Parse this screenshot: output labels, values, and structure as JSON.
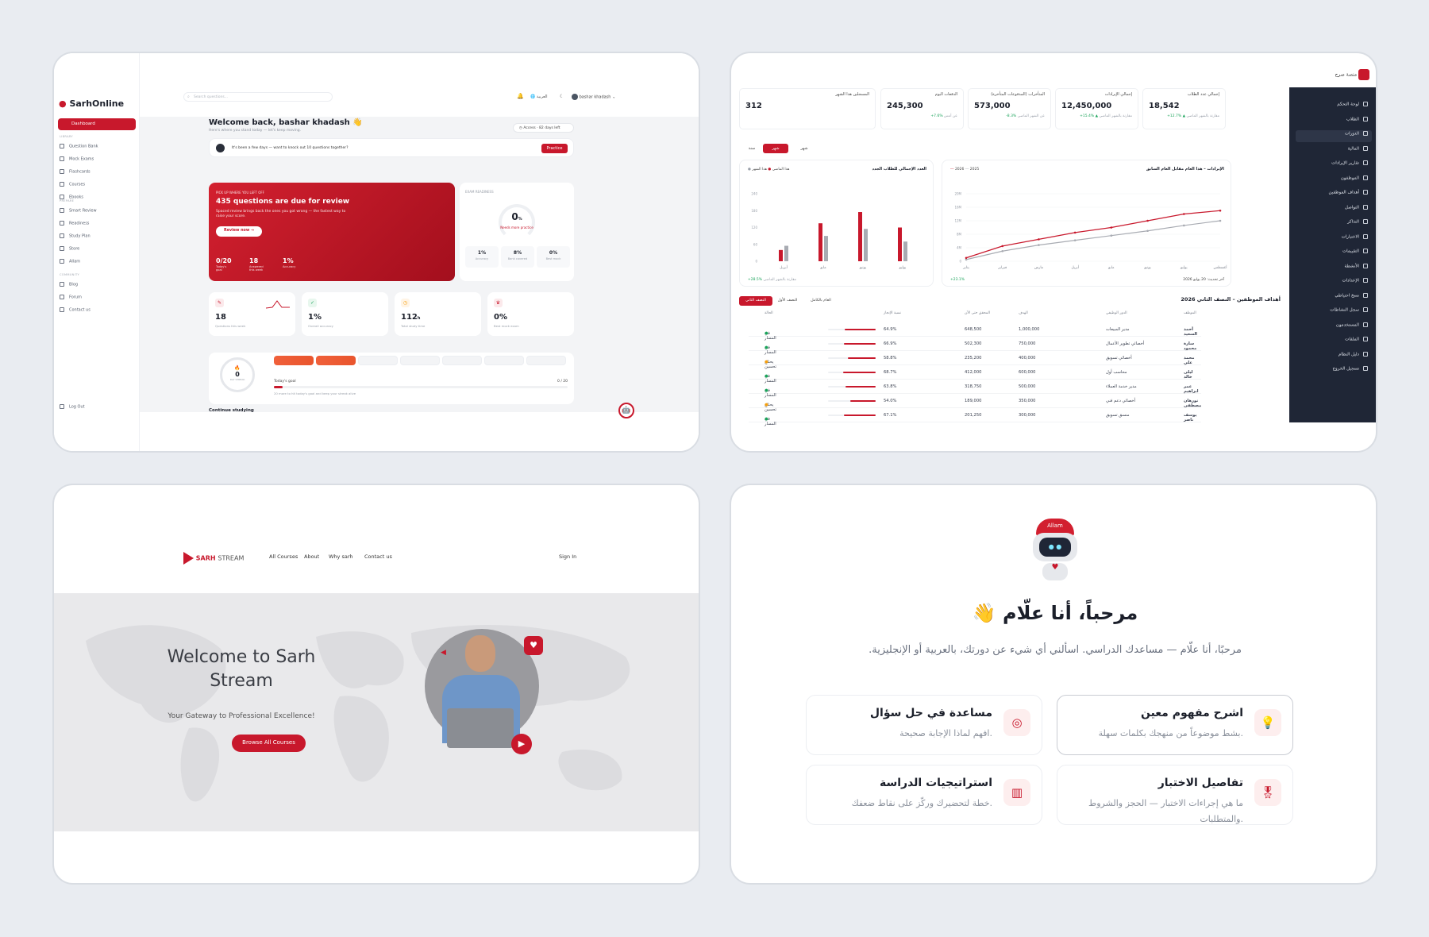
{
  "lms": {
    "logo": "SarhOnline",
    "search_placeholder": "Search questions...",
    "lang": "العربية",
    "user": "bashar khadash",
    "sidebar": {
      "active": "Dashboard",
      "sec1": "LIBRARY",
      "library": [
        "Question Bank",
        "Mock Exams",
        "Flashcards",
        "Courses",
        "Ebooks"
      ],
      "sec2": "PREPARE",
      "prepare": [
        "Smart Review",
        "Readiness",
        "Study Plan",
        "Store",
        "Allam"
      ],
      "sec3": "COMMUNITY",
      "community": [
        "Blog",
        "Forum",
        "Contact us"
      ],
      "logout": "Log Out"
    },
    "welcome": "Welcome back, bashar khadash 👋",
    "welcome_sub": "Here's where you stand today — let's keep moving.",
    "access": "Access · 82 days left",
    "nudge": "It's been a few days — want to knock out 10 questions together?",
    "nudge_btn": "Practice",
    "hero": {
      "kicker": "PICK UP WHERE YOU LEFT OFF",
      "title": "435 questions are due for review",
      "desc": "Spaced review brings back the ones you got wrong — the fastest way to raise your score.",
      "btn": "Review now →",
      "stats": [
        {
          "v": "0/20",
          "l": "Today's goal"
        },
        {
          "v": "18",
          "l": "Answered this week"
        },
        {
          "v": "1%",
          "l": "Accuracy"
        }
      ]
    },
    "readiness": {
      "label": "EXAM READINESS",
      "value": "0",
      "unit": "%",
      "status": "Needs more practice",
      "stats": [
        {
          "v": "1%",
          "l": "Accuracy"
        },
        {
          "v": "8%",
          "l": "Bank covered"
        },
        {
          "v": "0%",
          "l": "Best mock"
        }
      ]
    },
    "tiles": [
      {
        "v": "18",
        "l": "Questions this week",
        "icon": "quiz-icon"
      },
      {
        "v": "1%",
        "l": "Overall accuracy",
        "icon": "check-icon"
      },
      {
        "v": "112",
        "u": "h",
        "l": "Total study time",
        "icon": "clock-icon"
      },
      {
        "v": "0%",
        "l": "Best mock exam",
        "icon": "trophy-icon"
      }
    ],
    "streak": {
      "v": "0",
      "l": "DAY STREAK"
    },
    "goal_label": "Today's goal",
    "goal_value": "0 / 20",
    "goal_note": "20 more to hit today's goal and keep your streak alive",
    "continue": "Continue studying"
  },
  "admin": {
    "brand": "منصة صرح",
    "menu": [
      "لوحة التحكم",
      "الطلاب",
      "الدورات",
      "المالية",
      "تقارير الإيرادات",
      "الموظفون",
      "أهداف الموظفين",
      "التواصل",
      "التذاكر",
      "الاختبارات",
      "التقييمات",
      "الأنشطة",
      "الإعدادات",
      "نسخ احتياطي",
      "سجل النشاطات",
      "المستخدمون",
      "الملفات",
      "دليل النظام",
      "تسجيل الخروج"
    ],
    "kpis": [
      {
        "l": "إجمالي عدد الطلاب",
        "v": "18,542",
        "g": "+12.7% ▲",
        "n": "مقارنة بالشهر الماضي"
      },
      {
        "l": "إجمالي الإيرادات",
        "v": "12,450,000",
        "g": "+15.4% ▲",
        "n": "مقارنة بالشهر الماضي"
      },
      {
        "l": "المتأخرات (المدفوعات المتأخرة)",
        "v": "573,000",
        "g": "-8.3%",
        "n": "عن الشهر الماضي"
      },
      {
        "l": "الدفعات اليوم",
        "v": "245,300",
        "g": "+7.6%",
        "n": "عن أمس"
      },
      {
        "l": "المسجلين هذا الشهر",
        "v": "312",
        "g": "",
        "n": ""
      }
    ],
    "tabs": [
      "شهر",
      "شهر",
      "سنة"
    ],
    "line_title": "الإيرادات – هذا العام مقابل العام السابق",
    "line_legend": [
      "2026",
      "2025"
    ],
    "line_months": [
      "يناير",
      "فبراير",
      "مارس",
      "أبريل",
      "مايو",
      "يونيو",
      "يوليو",
      "أغسطس"
    ],
    "line_foot": "+23.1%",
    "line_note": "آخر تحديث: 20 يوليو 2026",
    "bar_title": "العدد الإجمالي للطلاب الجدد",
    "bar_legend": [
      "هذا الشهر",
      "هذا الماضي"
    ],
    "bar_foot": "+28.5%",
    "bar_note": "مقارنة بالشهر الماضي",
    "table_title": "أهداف الموظفين – النصف الثاني 2026",
    "table_tabs": [
      "العام بالكامل",
      "النصف الأول",
      "النصف الثاني"
    ],
    "headers": [
      "الموظف",
      "الدور الوظيفي",
      "الهدف",
      "المحقق حتى الآن",
      "نسبة الإنجاز",
      "الحالة"
    ],
    "rows": [
      [
        "أحمد السعيد",
        "مدير المبيعات",
        "1,000,000",
        "648,500",
        "64.9%",
        "في المسار"
      ],
      [
        "سارة محمود",
        "أخصائي تطوير الأعمال",
        "750,000",
        "502,300",
        "66.9%",
        "في المسار"
      ],
      [
        "محمد علي",
        "أخصائي تسويق",
        "400,000",
        "235,200",
        "58.8%",
        "يحتاج تحسين"
      ],
      [
        "ليلى خالد",
        "محاسب أول",
        "600,000",
        "412,000",
        "68.7%",
        "في المسار"
      ],
      [
        "عمر ابراهيم",
        "مدير خدمة العملاء",
        "500,000",
        "318,750",
        "63.8%",
        "في المسار"
      ],
      [
        "نورهان مصطفى",
        "أخصائي دعم فني",
        "350,000",
        "189,000",
        "54.0%",
        "يحتاج تحسين"
      ],
      [
        "يوسف ناصر",
        "منسق تسويق",
        "300,000",
        "201,250",
        "67.1%",
        "في المسار"
      ]
    ]
  },
  "stream": {
    "brand_a": "SARH",
    "brand_b": "STREAM",
    "nav": [
      "All Courses",
      "About",
      "Why sarh",
      "Contact us"
    ],
    "signin": "Sign In",
    "title": "Welcome to Sarh Stream",
    "subtitle": "Your Gateway to Professional Excellence!",
    "cta": "Browse All Courses"
  },
  "assistant": {
    "bot_badge": "Allam",
    "greeting": "مرحباً، أنا علّام 👋",
    "intro": "مرحبًا، أنا علّام — مساعدك الدراسي. اسألني أي شيء عن دورتك، بالعربية أو الإنجليزية.",
    "cards": [
      {
        "title": "اشرح مفهوم معين",
        "desc": "بشط موضوعاً من منهجك بكلمات سهلة.",
        "icon": "lightbulb-icon"
      },
      {
        "title": "مساعدة في حل سؤال",
        "desc": "افهم لماذا الإجابة صحيحة.",
        "icon": "target-icon"
      },
      {
        "title": "تفاصيل الاختبار",
        "desc": "ما هي إجراءات الاختبار — الحجز والشروط والمتطلبات.",
        "icon": "badge-icon"
      },
      {
        "title": "استراتيجيات الدراسة",
        "desc": "خطة لتحضيرك وركّز على نقاط ضعفك.",
        "icon": "chart-icon"
      }
    ]
  },
  "chart_data": [
    {
      "type": "bar",
      "title": "العدد الإجمالي للطلاب الجدد",
      "categories": [
        "أبريل",
        "مايو",
        "يونيو",
        "يوليو"
      ],
      "ylim": [
        0,
        240
      ],
      "series": [
        {
          "name": "هذا الشهر",
          "values": [
            40,
            135,
            175,
            120
          ]
        },
        {
          "name": "هذا الماضي",
          "values": [
            55,
            90,
            115,
            70
          ]
        }
      ]
    },
    {
      "type": "line",
      "title": "الإيرادات – هذا العام مقابل العام السابق",
      "categories": [
        "يناير",
        "فبراير",
        "مارس",
        "أبريل",
        "مايو",
        "يونيو",
        "يوليو",
        "أغسطس"
      ],
      "ylim": [
        0,
        20
      ],
      "series": [
        {
          "name": "2026",
          "values": [
            1,
            4.5,
            6.5,
            8.5,
            10,
            12,
            14,
            15
          ]
        },
        {
          "name": "2025",
          "values": [
            0.5,
            3,
            4.8,
            6.2,
            7.6,
            9,
            10.6,
            12
          ]
        }
      ]
    }
  ]
}
